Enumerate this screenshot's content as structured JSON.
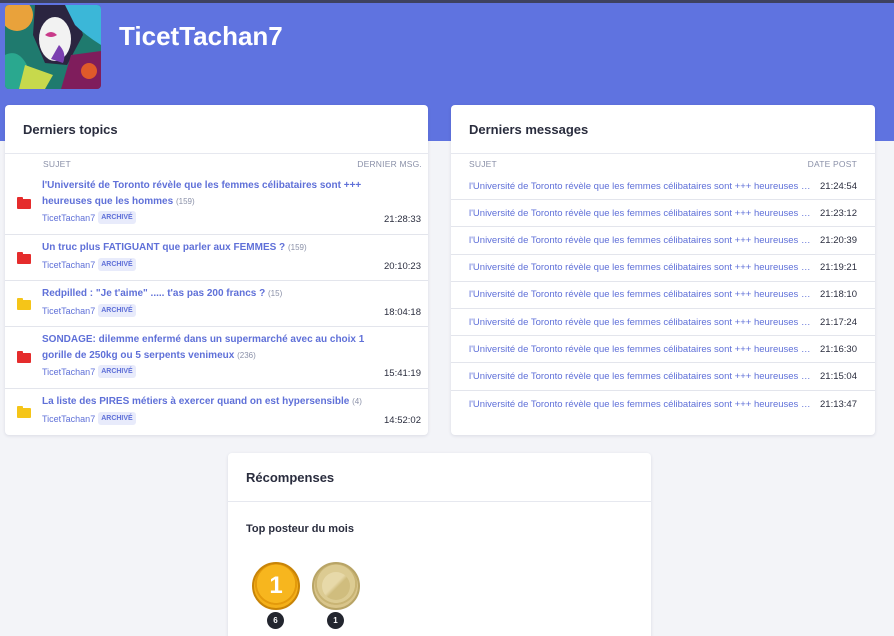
{
  "profile": {
    "username": "TicetTachan7"
  },
  "topics": {
    "title": "Derniers topics",
    "col_subject": "SUJET",
    "col_last": "DERNIER MSG.",
    "items": [
      {
        "title": "l'Université de Toronto révèle que les femmes célibataires sont +++ heureuses que les hommes",
        "count": "(159)",
        "author": "TicetTachan7",
        "badge": "ARCHIVÉ",
        "time": "21:28:33",
        "folder": "red"
      },
      {
        "title": "Un truc plus FATIGUANT que parler aux FEMMES ?",
        "count": "(159)",
        "author": "TicetTachan7",
        "badge": "ARCHIVÉ",
        "time": "20:10:23",
        "folder": "red"
      },
      {
        "title": "Redpilled : \"Je t'aime\" ..... t'as pas 200 francs ?",
        "count": "(15)",
        "author": "TicetTachan7",
        "badge": "ARCHIVÉ",
        "time": "18:04:18",
        "folder": "yellow"
      },
      {
        "title": "SONDAGE: dilemme enfermé dans un supermarché avec au choix 1 gorille de 250kg ou 5 serpents venimeux",
        "count": "(236)",
        "author": "TicetTachan7",
        "badge": "ARCHIVÉ",
        "time": "15:41:19",
        "folder": "red"
      },
      {
        "title": "La liste des PIRES métiers à exercer quand on est hypersensible",
        "count": "(4)",
        "author": "TicetTachan7",
        "badge": "ARCHIVÉ",
        "time": "14:52:02",
        "folder": "yellow"
      }
    ]
  },
  "messages": {
    "title": "Derniers messages",
    "col_subject": "SUJET",
    "col_date": "DATE POST",
    "items": [
      {
        "text": "l'Université de Toronto révèle que les femmes célibataires sont +++ heureuses que les hommes",
        "time": "21:24:54"
      },
      {
        "text": "l'Université de Toronto révèle que les femmes célibataires sont +++ heureuses que les hommes",
        "time": "21:23:12"
      },
      {
        "text": "l'Université de Toronto révèle que les femmes célibataires sont +++ heureuses que les hommes",
        "time": "21:20:39"
      },
      {
        "text": "l'Université de Toronto révèle que les femmes célibataires sont +++ heureuses que les hommes",
        "time": "21:19:21"
      },
      {
        "text": "l'Université de Toronto révèle que les femmes célibataires sont +++ heureuses que les hommes",
        "time": "21:18:10"
      },
      {
        "text": "l'Université de Toronto révèle que les femmes célibataires sont +++ heureuses que les hommes",
        "time": "21:17:24"
      },
      {
        "text": "l'Université de Toronto révèle que les femmes célibataires sont +++ heureuses que les hommes",
        "time": "21:16:30"
      },
      {
        "text": "l'Université de Toronto révèle que les femmes célibataires sont +++ heureuses que les hommes",
        "time": "21:15:04"
      },
      {
        "text": "l'Université de Toronto révèle que les femmes célibataires sont +++ heureuses que les hommes",
        "time": "21:13:47"
      }
    ]
  },
  "rewards": {
    "title": "Récompenses",
    "subtitle": "Top posteur du mois",
    "medals": [
      {
        "label": "1",
        "count": "6",
        "kind": "gold"
      },
      {
        "label": "",
        "count": "1",
        "kind": "grey"
      }
    ]
  },
  "colors": {
    "banner": "#5f73e0",
    "link": "#5f70d8",
    "folder_red": "#e52c2c",
    "folder_yellow": "#f5c518"
  }
}
